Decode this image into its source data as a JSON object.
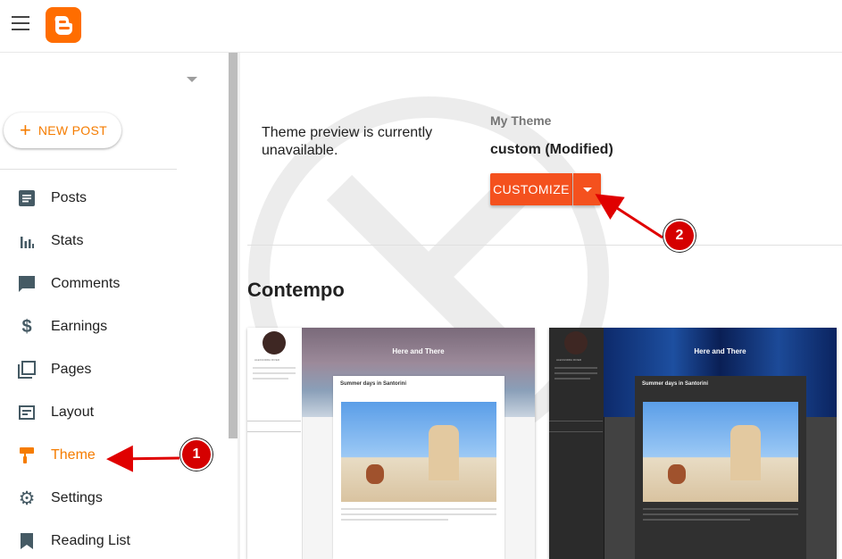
{
  "header": {
    "menu_icon": "hamburger-menu-icon",
    "logo_icon": "blogger-logo-icon"
  },
  "sidebar": {
    "new_post_label": "NEW POST",
    "items": [
      {
        "label": "Posts",
        "icon": "posts-icon"
      },
      {
        "label": "Stats",
        "icon": "stats-icon"
      },
      {
        "label": "Comments",
        "icon": "comments-icon"
      },
      {
        "label": "Earnings",
        "icon": "earnings-icon"
      },
      {
        "label": "Pages",
        "icon": "pages-icon"
      },
      {
        "label": "Layout",
        "icon": "layout-icon"
      },
      {
        "label": "Theme",
        "icon": "theme-icon",
        "active": true
      },
      {
        "label": "Settings",
        "icon": "settings-icon"
      },
      {
        "label": "Reading List",
        "icon": "reading-list-icon"
      }
    ]
  },
  "main": {
    "preview_message": "Theme preview is currently unavailable.",
    "my_theme_label": "My Theme",
    "theme_name": "custom (Modified)",
    "customize_label": "CUSTOMIZE",
    "section_title": "Contempo"
  },
  "theme_cards": [
    {
      "variant": "light",
      "blog_title": "Here and There",
      "post_title": "Summer days in Santorini",
      "author": "ALEXANDRA RIVER"
    },
    {
      "variant": "dark",
      "blog_title": "Here and There",
      "post_title": "Summer days in Santorini",
      "author": "ALEXANDRA RIVER"
    }
  ],
  "annotations": {
    "badge_1": "1",
    "badge_2": "2"
  },
  "colors": {
    "accent": "#f57c00",
    "button": "#f4511e",
    "badge": "#d50000",
    "arrow": "#e00000"
  }
}
